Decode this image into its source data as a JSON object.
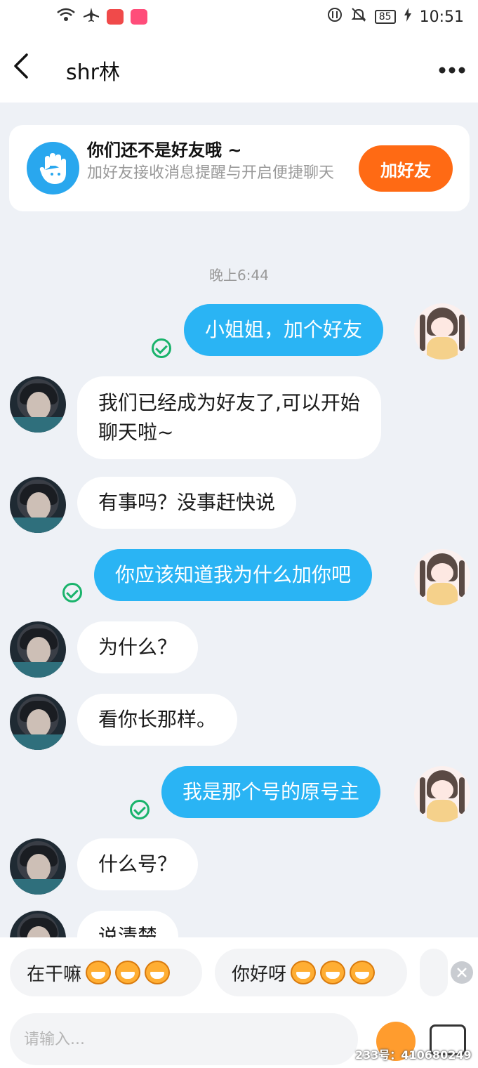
{
  "status_bar": {
    "time": "10:51",
    "battery": "85"
  },
  "header": {
    "back_icon": "chevron-left-icon",
    "title": "shr林",
    "more_icon": "more-dots-icon"
  },
  "friend_card": {
    "icon": "hand-icon",
    "title": "你们还不是好友哦 ~",
    "subtitle": "加好友接收消息提醒与开启便捷聊天",
    "button": "加好友"
  },
  "timestamp": "晚上6:44",
  "messages": [
    {
      "side": "out",
      "text": "小姐姐，加个好友"
    },
    {
      "side": "in",
      "text": "我们已经成为好友了,可以开始\n聊天啦~"
    },
    {
      "side": "in",
      "text": "有事吗？没事赶快说"
    },
    {
      "side": "out",
      "text": "你应该知道我为什么加你吧"
    },
    {
      "side": "in",
      "text": "为什么？"
    },
    {
      "side": "in",
      "text": "看你长那样。"
    },
    {
      "side": "out",
      "text": "我是那个号的原号主"
    },
    {
      "side": "in",
      "text": "什么号？"
    },
    {
      "side": "in",
      "text": "说清楚"
    }
  ],
  "quick_replies": [
    "在干嘛",
    "你好呀"
  ],
  "input": {
    "placeholder": "请输入..."
  },
  "watermark": "233号：410680249",
  "colors": {
    "accent": "#2ab4f4",
    "add_button": "#ff6a14",
    "read_check": "#19b36b"
  }
}
